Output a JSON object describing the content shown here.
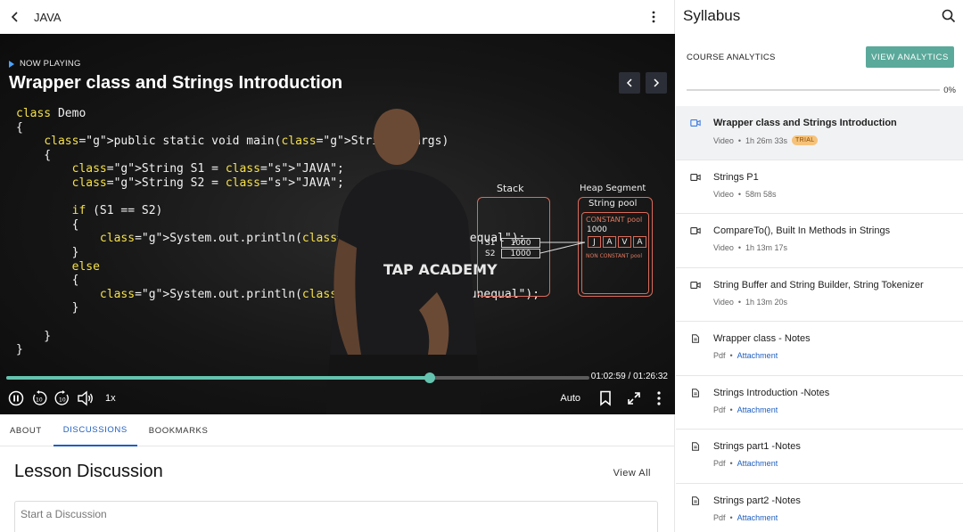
{
  "header": {
    "title": "JAVA"
  },
  "player": {
    "now_playing": "NOW PLAYING",
    "title": "Wrapper class and Strings Introduction",
    "current_time": "01:02:59",
    "duration": "01:26:32",
    "progress": 0.727,
    "speed": "1x",
    "quality": "Auto"
  },
  "slide": {
    "code_lines": [
      "class Demo",
      "{",
      "    public static void main(String...args)",
      "    {",
      "        String S1 = \"JAVA\";",
      "        String S2 = \"JAVA\";",
      "",
      "        if (S1 == S2)",
      "        {",
      "            System.out.println(\"reference is equal\");",
      "        }",
      "        else",
      "        {",
      "            System.out.println(\"reference is unequal\");",
      "        }",
      "",
      "    }",
      "}"
    ],
    "stack_label": "Stack",
    "heap_label": "Heap Segment",
    "pool_label": "String pool",
    "constant_pool": "CONSTANT pool",
    "non_constant_pool": "NON CONSTANT pool",
    "s1": "S1",
    "s2": "S2",
    "ref1": "1000",
    "ref2": "1000",
    "addr": "1000",
    "chars": [
      "J",
      "A",
      "V",
      "A"
    ],
    "logo": "TAP ACADEMY"
  },
  "tabs": [
    {
      "label": "ABOUT",
      "active": false
    },
    {
      "label": "DISCUSSIONS",
      "active": true
    },
    {
      "label": "BOOKMARKS",
      "active": false
    }
  ],
  "discussion": {
    "title": "Lesson Discussion",
    "view_all": "View All",
    "placeholder": "Start a Discussion"
  },
  "syllabus": {
    "title": "Syllabus",
    "analytics_label": "COURSE ANALYTICS",
    "analytics_button": "VIEW ANALYTICS",
    "completion": "0%",
    "items": [
      {
        "name": "Wrapper class and Strings Introduction",
        "type": "Video",
        "duration": "1h 26m 33s",
        "badge": "TRIAL",
        "icon": "video-icon",
        "active": true
      },
      {
        "name": "Strings P1",
        "type": "Video",
        "duration": "58m 58s",
        "icon": "video-icon"
      },
      {
        "name": "CompareTo(), Built In Methods in Strings",
        "type": "Video",
        "duration": "1h 13m 17s",
        "icon": "video-icon"
      },
      {
        "name": "String Buffer and String Builder, String Tokenizer",
        "type": "Video",
        "duration": "1h 13m 20s",
        "icon": "video-icon"
      },
      {
        "name": "Wrapper class - Notes",
        "type": "Pdf",
        "duration": "Attachment",
        "icon": "document-icon"
      },
      {
        "name": "Strings Introduction -Notes",
        "type": "Pdf",
        "duration": "Attachment",
        "icon": "document-icon"
      },
      {
        "name": "Strings part1 -Notes",
        "type": "Pdf",
        "duration": "Attachment",
        "icon": "document-icon"
      },
      {
        "name": "Strings part2 -Notes",
        "type": "Pdf",
        "duration": "Attachment",
        "icon": "document-icon"
      }
    ]
  },
  "colors": {
    "accent": "#5ba99a",
    "progress": "#64c3ae",
    "link": "#1f5fbf",
    "trial_bg": "#f6c27a"
  }
}
